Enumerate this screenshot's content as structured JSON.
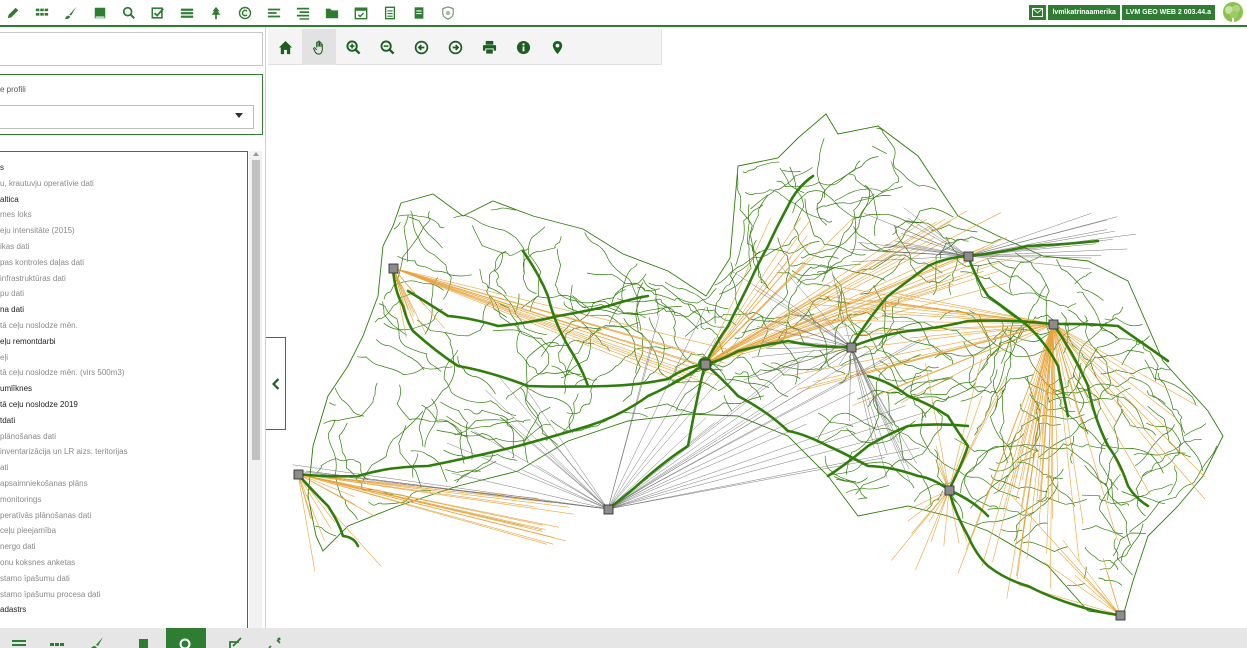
{
  "header": {
    "badges": {
      "user": "lvm\\katrinaamerika",
      "version": "LVM GEO WEB 2 003.44.a"
    },
    "icons": [
      "edit-icon",
      "grid-icon",
      "brush-icon",
      "book-icon",
      "search-icon",
      "checklist-icon",
      "layers-icon",
      "tree-icon",
      "copyright-icon",
      "list-icon",
      "align-icon",
      "folder-icon",
      "calendar-check-icon",
      "document-icon",
      "document-filled-icon",
      "shield-icon"
    ]
  },
  "leftpanel": {
    "search_value": "",
    "profile_label": "e profili",
    "profile_value": "",
    "layers": [
      {
        "label": "s",
        "tone": "dark"
      },
      {
        "label": "u, krautuvju operatīvie dati",
        "tone": "dim"
      },
      {
        "label": "altica",
        "tone": "dark"
      },
      {
        "label": "mes loks",
        "tone": "dim"
      },
      {
        "label": "eju intensitāte (2015)",
        "tone": "dim"
      },
      {
        "label": "ikas dati",
        "tone": "dim"
      },
      {
        "label": "pas kontroles daļas dati",
        "tone": "dim"
      },
      {
        "label": "infrastruktūras dati",
        "tone": "dim"
      },
      {
        "label": "pu dati",
        "tone": "dim"
      },
      {
        "label": "na dati",
        "tone": "dark"
      },
      {
        "label": "tā ceļu noslodze mēn.",
        "tone": "dim"
      },
      {
        "label": "eļu remontdarbi",
        "tone": "dark"
      },
      {
        "label": "eļi",
        "tone": "dim"
      },
      {
        "label": "tā ceļu noslodze mēn. (virs 500m3)",
        "tone": "dim"
      },
      {
        "label": "umlīknes",
        "tone": "dark"
      },
      {
        "label": "tā ceļu noslodze 2019",
        "tone": "dark"
      },
      {
        "label": "tdati",
        "tone": "dark"
      },
      {
        "label": "plānošanas dati",
        "tone": "dim"
      },
      {
        "label": "inventarizācija un LR aizs. teritorijas",
        "tone": "dim"
      },
      {
        "label": "ati",
        "tone": "dim"
      },
      {
        "label": "apsaimniekošanas plāns",
        "tone": "dim"
      },
      {
        "label": "monitorings",
        "tone": "dim"
      },
      {
        "label": "peratīvās plānošanas dati",
        "tone": "dim"
      },
      {
        "label": "ceļu pieejamība",
        "tone": "dim"
      },
      {
        "label": "nergo dati",
        "tone": "dim"
      },
      {
        "label": "onu koksnes anketas",
        "tone": "dim"
      },
      {
        "label": "stamo īpašumu dati",
        "tone": "dim"
      },
      {
        "label": "stamo īpašumu procesa dati",
        "tone": "dim"
      },
      {
        "label": "adastrs",
        "tone": "dark"
      }
    ]
  },
  "maptoolbar": {
    "tools": [
      "home-icon",
      "pan-hand-icon",
      "zoom-in-icon",
      "zoom-out-icon",
      "back-icon",
      "forward-icon",
      "print-icon",
      "info-icon",
      "location-pin-icon"
    ],
    "active_tool": "pan-hand-icon"
  },
  "colors": {
    "brand": "#2e7d32",
    "roads": "#2f7d0a",
    "flows_orange": "#e8a33c",
    "flows_gray": "#6b6b6b"
  },
  "bottombar": {
    "icons": [
      "list-icon",
      "grid-icon",
      "brush-icon",
      "book-icon",
      "search-icon",
      "checklist-icon",
      "edit-icon"
    ],
    "active": "search-icon"
  }
}
